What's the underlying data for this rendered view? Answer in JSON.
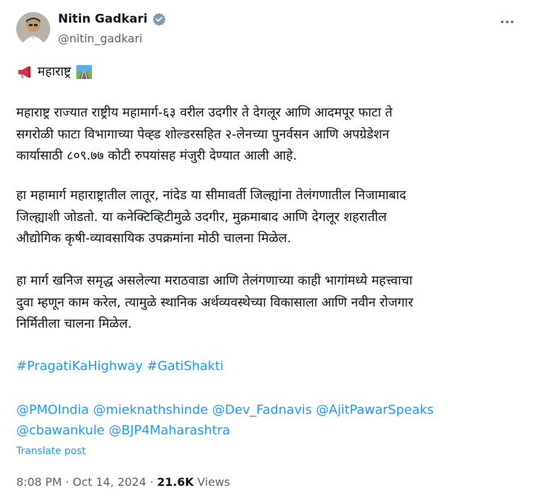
{
  "author": {
    "name": "Nitin Gadkari",
    "handle": "@nitin_gadkari",
    "verified_color": "#829aab"
  },
  "tweet": {
    "headline": "महाराष्ट्र",
    "headline_icons": [
      "megaphone-icon",
      "railway-track-icon"
    ],
    "paragraph1": [
      "महाराष्ट्र राज्यात राष्ट्रीय महामार्ग-६३ वरील उदगीर ते देगलूर आणि आदमपूर फाटा ते",
      "सगरोळी फाटा विभागाच्या पेव्ह्ड शोल्डरसहित २-लेनच्या पुनर्वसन आणि अपग्रेडेशन",
      "कार्यासाठी ८०९.७७ कोटी रुपयांसह मंजुरी देण्यात आली आहे."
    ],
    "paragraph2": [
      "हा महामार्ग महाराष्ट्रातील लातूर, नांदेड या सीमावर्ती जिल्ह्यांना तेलंगणातील निजामाबाद",
      "जिल्ह्याशी जोडतो. या कनेक्टिव्हिटीमुळे उदगीर, मुक्रमाबाद आणि देगलूर शहरातील",
      "औद्योगिक कृषी-व्यावसायिक उपक्रमांना मोठी चालना मिळेल."
    ],
    "paragraph3": [
      "हा मार्ग खनिज समृद्ध असलेल्या मराठवाडा आणि तेलंगणाच्या काही भागांमध्ये महत्त्वाचा",
      "दुवा म्हणून काम करेल, त्यामुळे स्थानिक अर्थव्यवस्थेच्या विकासाला आणि नवीन रोजगार",
      "निर्मितीला चालना मिळेल."
    ],
    "hashtags": [
      "#PragatiKaHighway",
      "#GatiShakti"
    ],
    "mentions_line1": [
      "@PMOIndia",
      "@mieknathshinde",
      "@Dev_Fadnavis",
      "@AjitPawarSpeaks"
    ],
    "mentions_line2": [
      "@cbawankule",
      "@BJP4Maharashtra"
    ]
  },
  "translate_label": "Translate post",
  "meta": {
    "time": "8:08 PM",
    "separator": "·",
    "date": "Oct 14, 2024",
    "views_count": "21.6K",
    "views_label": "Views"
  },
  "colors": {
    "link": "#1d9bf0",
    "muted": "#536471",
    "text": "#0f1419"
  }
}
